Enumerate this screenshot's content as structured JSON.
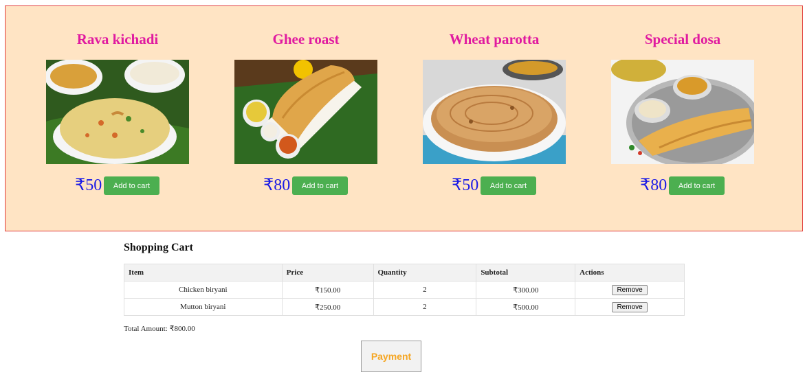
{
  "menu": {
    "items": [
      {
        "name": "Rava kichadi",
        "price": "₹50",
        "button": "Add to cart",
        "image": "rava-kichadi-photo"
      },
      {
        "name": "Ghee roast",
        "price": "₹80",
        "button": "Add to cart",
        "image": "ghee-roast-photo"
      },
      {
        "name": "Wheat parotta",
        "price": "₹50",
        "button": "Add to cart",
        "image": "wheat-parotta-photo"
      },
      {
        "name": "Special dosa",
        "price": "₹80",
        "button": "Add to cart",
        "image": "special-dosa-photo"
      }
    ]
  },
  "cart": {
    "title": "Shopping Cart",
    "columns": [
      "Item",
      "Price",
      "Quantity",
      "Subtotal",
      "Actions"
    ],
    "rows": [
      {
        "item": "Chicken biryani",
        "price": "₹150.00",
        "quantity": "2",
        "subtotal": "₹300.00",
        "action": "Remove"
      },
      {
        "item": "Mutton biryani",
        "price": "₹250.00",
        "quantity": "2",
        "subtotal": "₹500.00",
        "action": "Remove"
      }
    ],
    "total": "Total Amount: ₹800.00",
    "payment_button": "Payment"
  },
  "colors": {
    "panel_bg": "#ffe4c4",
    "panel_border": "#e03a3a",
    "title": "#e01aa0",
    "price": "#1a1ae6",
    "add_button": "#4caf50",
    "payment_text": "#f5a623"
  }
}
